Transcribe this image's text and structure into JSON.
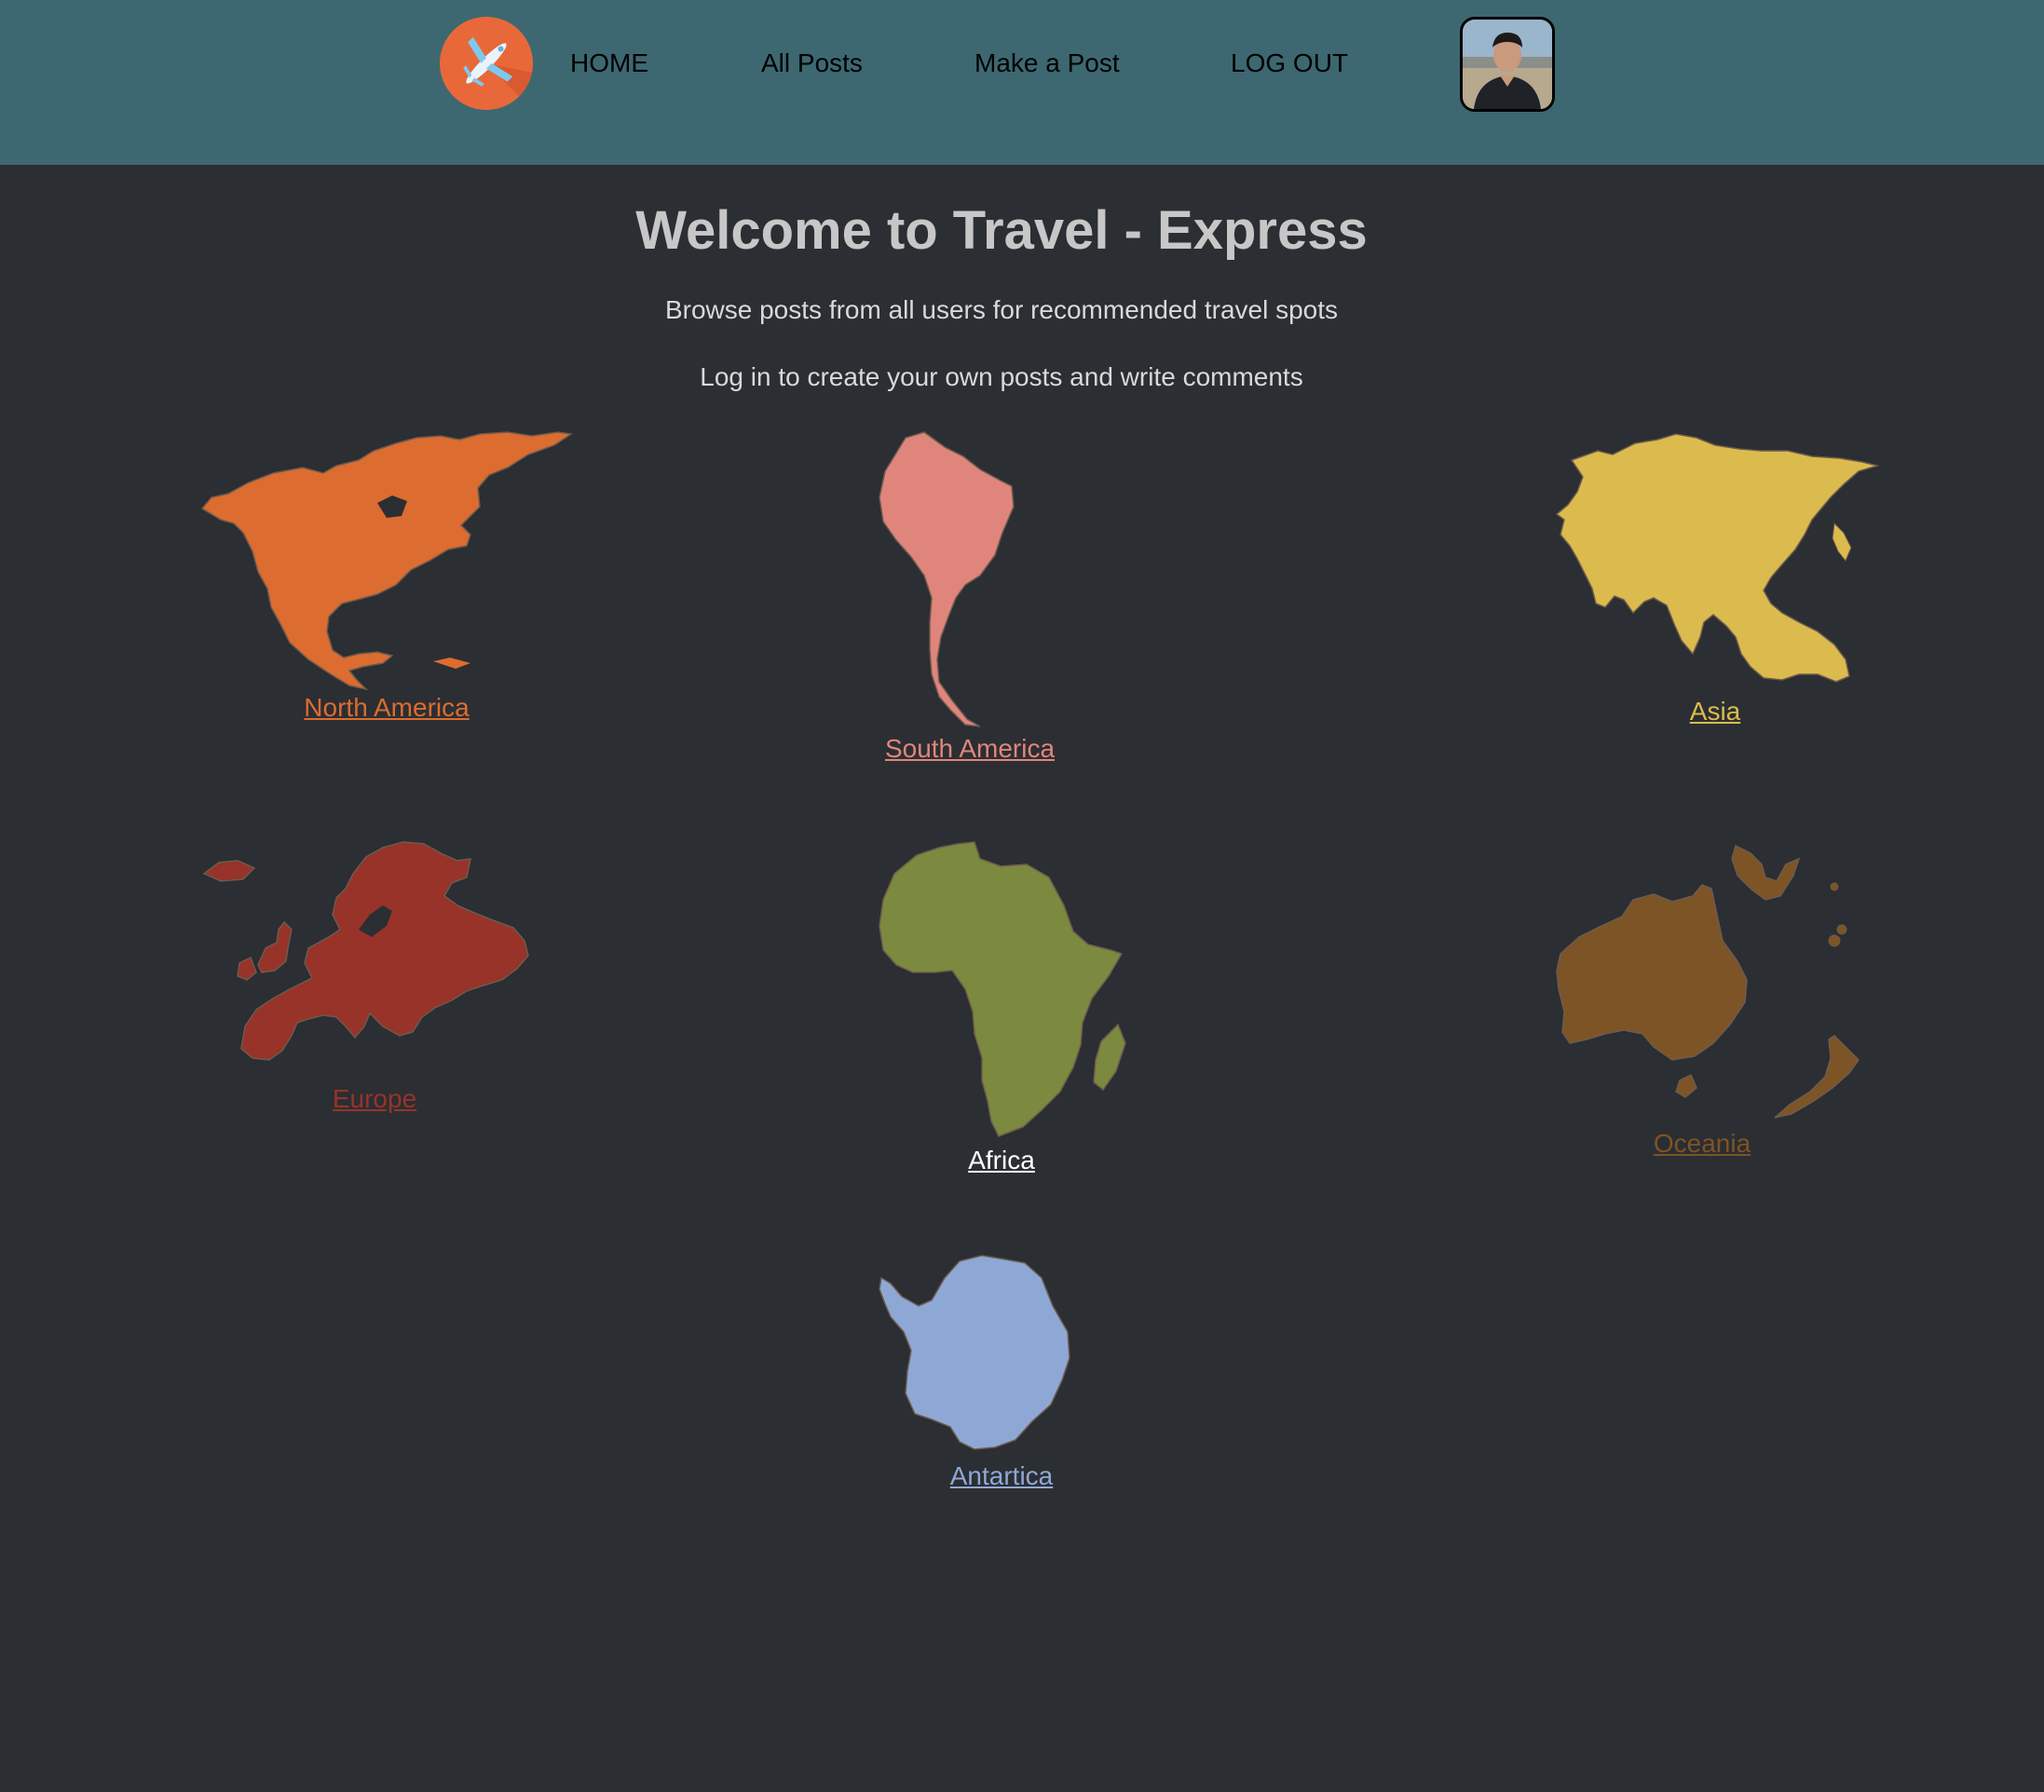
{
  "nav": {
    "logo_icon": "airplane-icon",
    "links": [
      "HOME",
      "All Posts",
      "Make a Post",
      "LOG OUT"
    ],
    "avatar": "user-avatar"
  },
  "hero": {
    "title": "Welcome to Travel - Express",
    "line1": "Browse posts from all users for recommended travel spots",
    "line2": "Log in to create your own posts and write comments"
  },
  "continents": {
    "north_america": {
      "label": "North America",
      "color": "#dc6c2f"
    },
    "south_america": {
      "label": "South America",
      "color": "#e0857c"
    },
    "asia": {
      "label": "Asia",
      "color": "#dbbb4d"
    },
    "europe": {
      "label": "Europe",
      "color": "#973329"
    },
    "africa": {
      "label": "Africa",
      "color": "#ffffff",
      "shape_color": "#7b8a3e"
    },
    "oceania": {
      "label": "Oceania",
      "color": "#7d5426"
    },
    "antarctica": {
      "label": "Antartica",
      "color": "#8ea8d5"
    }
  },
  "colors": {
    "navbar": "#3d6871",
    "background": "#2b2e32",
    "logo": "#e8683a"
  }
}
